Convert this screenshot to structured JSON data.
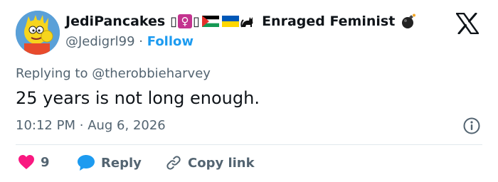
{
  "author": {
    "display_name": "JediPancakes",
    "display_suffix": "Enraged Feminist",
    "handle": "@Jedigrl99",
    "separator": "·",
    "follow_label": "Follow",
    "name_glyph_placeholder": "▯",
    "female_symbol": "♀",
    "cat_symbol": "🐈‍⬛",
    "bomb_symbol": "💣"
  },
  "platform": {
    "logo_icon": "x-logo-icon"
  },
  "tweet": {
    "replying_to_prefix": "Replying to",
    "replying_to_handle": "@therobbieharvey",
    "text": "25 years is not long enough.",
    "time": "10:12 PM",
    "dot": "·",
    "date": "Aug 6, 2026"
  },
  "actions": {
    "like_count": "9",
    "reply_label": "Reply",
    "copy_link_label": "Copy link"
  },
  "colors": {
    "text": "#0f1419",
    "secondary": "#536471",
    "link": "#1d9bf0",
    "like": "#f91880",
    "reply_icon": "#1d9bf0"
  }
}
